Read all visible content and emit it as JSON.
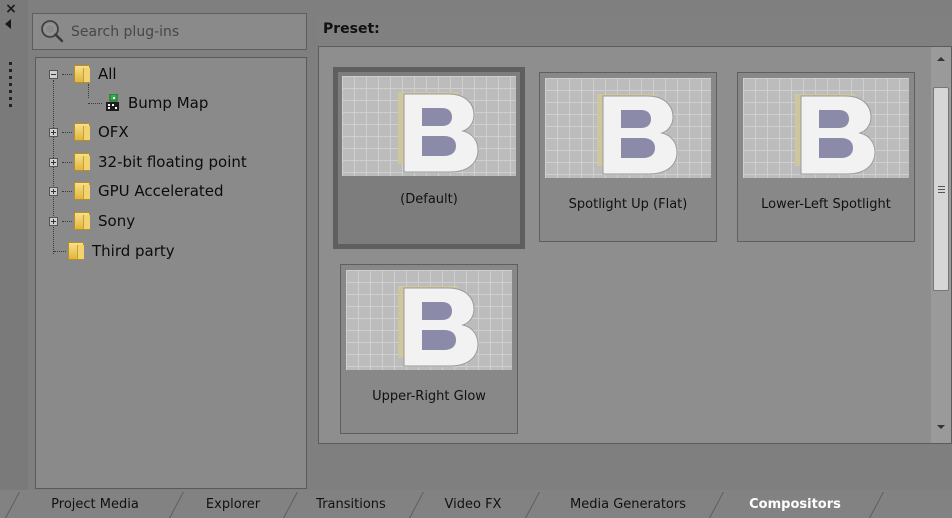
{
  "search": {
    "placeholder": "Search plug-ins"
  },
  "tree": {
    "items": [
      {
        "label": "All",
        "expander": "minus",
        "kind": "folder"
      },
      {
        "label": "Bump Map",
        "kind": "plugin"
      },
      {
        "label": "OFX",
        "expander": "plus",
        "kind": "folder"
      },
      {
        "label": "32-bit floating point",
        "expander": "plus",
        "kind": "folder"
      },
      {
        "label": "GPU Accelerated",
        "expander": "plus",
        "kind": "folder"
      },
      {
        "label": "Sony",
        "expander": "plus",
        "kind": "folder"
      },
      {
        "label": "Third party",
        "kind": "folder"
      }
    ]
  },
  "preset": {
    "title": "Preset:",
    "items": [
      {
        "label": "(Default)",
        "selected": true
      },
      {
        "label": "Spotlight Up (Flat)"
      },
      {
        "label": "Lower-Left Spotlight"
      },
      {
        "label": "Upper-Right Glow"
      }
    ]
  },
  "tabs": [
    {
      "label": "Project Media"
    },
    {
      "label": "Explorer"
    },
    {
      "label": "Transitions"
    },
    {
      "label": "Video FX"
    },
    {
      "label": "Media Generators"
    },
    {
      "label": "Compositors",
      "active": true
    }
  ],
  "icons": {
    "close": "close-icon",
    "pin": "pin-arrow-icon",
    "grip": "grip-icon",
    "search": "search-icon",
    "folder": "folder-icon",
    "plugin": "plugin-icon"
  },
  "colors": {
    "background": "#7f7f7f",
    "panel": "#8e8e8e",
    "active_tab_text": "#ffffff"
  }
}
